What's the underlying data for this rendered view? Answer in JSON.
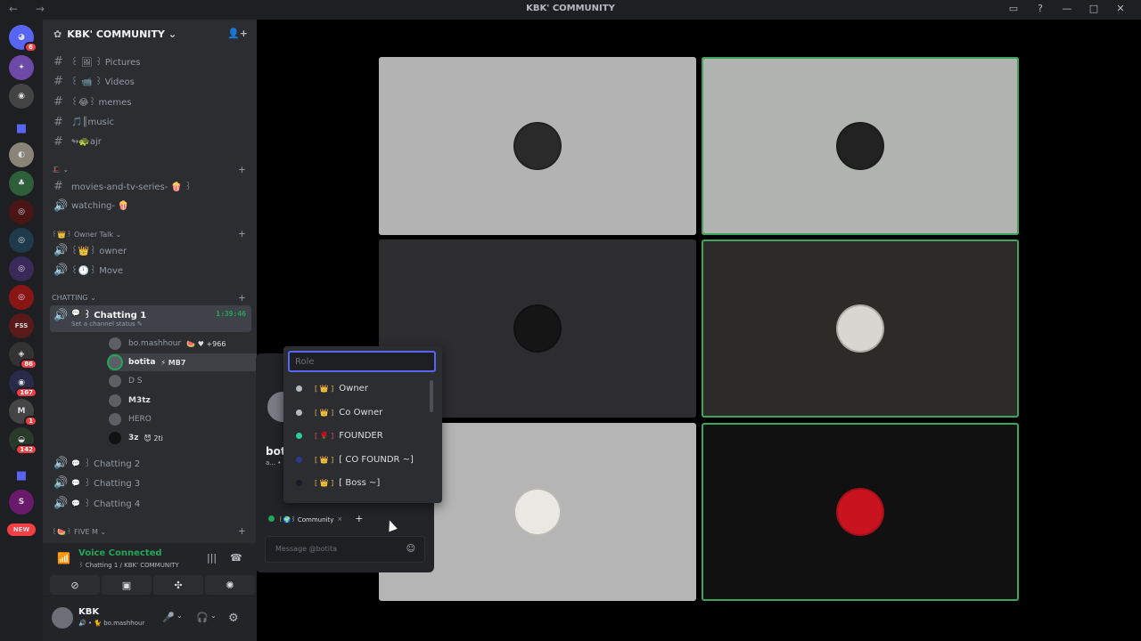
{
  "window": {
    "title": "KBK' COMMUNITY",
    "nav": "← →"
  },
  "colors": {
    "accent": "#5865f2",
    "online": "#23a55a",
    "danger": "#f23f43"
  },
  "rail": {
    "home_badge": "6",
    "badge_86": "86",
    "badge_167": "167",
    "badge_1": "1",
    "badge_142": "142",
    "new_label": "NEW",
    "fss_label": "FSS"
  },
  "guild": {
    "name": "KBK' COMMUNITY",
    "channels": {
      "pictures": "꒰ 🖼 ꒱ Pictures",
      "videos": "꒰ 📹 ꒱ Videos",
      "memes": "꒰😂꒱ memes",
      "music": "🎵║music",
      "ajr": "↬🐢ajr",
      "movies": "movies-and-tv-series- 🍿 ꒱",
      "watching": "watching- 🍿",
      "owner": "꒰👑꒱ owner",
      "move": "꒰🕛꒱ Move",
      "chatting1": "꒱ Chatting 1",
      "chatting2": "꒱ Chatting 2",
      "chatting3": "꒱ Chatting 3",
      "chatting4": "꒱ Chatting 4"
    },
    "categories": {
      "unnamed": "🎩 ⌄",
      "owner_talk": "꒰👑꒱ Owner Talk ⌄",
      "chatting": "CHATTING ⌄",
      "five_m": "꒰🍉꒱ FIVE M ⌄"
    },
    "chatting1_timer": "1:39:46",
    "chatting1_status": "Set a channel status ✎",
    "voice_users": [
      {
        "name": "bo.mashhour",
        "extra": "🍉  ♥ +966"
      },
      {
        "name": "botita",
        "extra": "⚡ MB7"
      },
      {
        "name": "D S",
        "extra": ""
      },
      {
        "name": "M3tz",
        "extra": ""
      },
      {
        "name": "HERO",
        "extra": ""
      },
      {
        "name": "3z",
        "extra": "😈 2ti"
      }
    ]
  },
  "voice_panel": {
    "status": "Voice Connected",
    "location": "꒱ Chatting 1 / KBK' COMMUNITY"
  },
  "user_panel": {
    "name": "KBK",
    "sub": "🔊 • 🐈 bo.mashhour"
  },
  "popout": {
    "name_partial": "bot",
    "sub_partial": "a... •",
    "role_tag": "꒰🌍꒱ Community",
    "message_placeholder": "Message @botita"
  },
  "role_dropdown": {
    "placeholder": "Role",
    "options": [
      {
        "label": "Owner",
        "prefix": "[ 👑 ]",
        "color": "#b5bac1"
      },
      {
        "label": "Co Owner",
        "prefix": "[ 👑 ]",
        "color": "#b5bac1"
      },
      {
        "label": "FOUNDER",
        "prefix": "[ 🌹 ]",
        "color": "#2ecc9b"
      },
      {
        "label": "[ CO FOUNDR ~]",
        "prefix": "[ 👑 ]",
        "color": "#2c3a8c"
      },
      {
        "label": "[ Boss ~]",
        "prefix": "[ 👑 ]",
        "color": "#1a1a2a"
      }
    ]
  },
  "video_tiles": [
    {
      "bg": "#b3b3b3",
      "speaking": false,
      "face": "#2a2a2a"
    },
    {
      "bg": "#b0b3b0",
      "speaking": true,
      "face": "#222"
    },
    {
      "bg": "#2d2d30",
      "speaking": false,
      "face": "#151515"
    },
    {
      "bg": "#2d2a27",
      "speaking": true,
      "face": "#d8d6d0"
    },
    {
      "bg": "#b5b5b5",
      "speaking": false,
      "face": "#eae8e2"
    },
    {
      "bg": "#111111",
      "speaking": true,
      "face": "#c9141f"
    }
  ]
}
